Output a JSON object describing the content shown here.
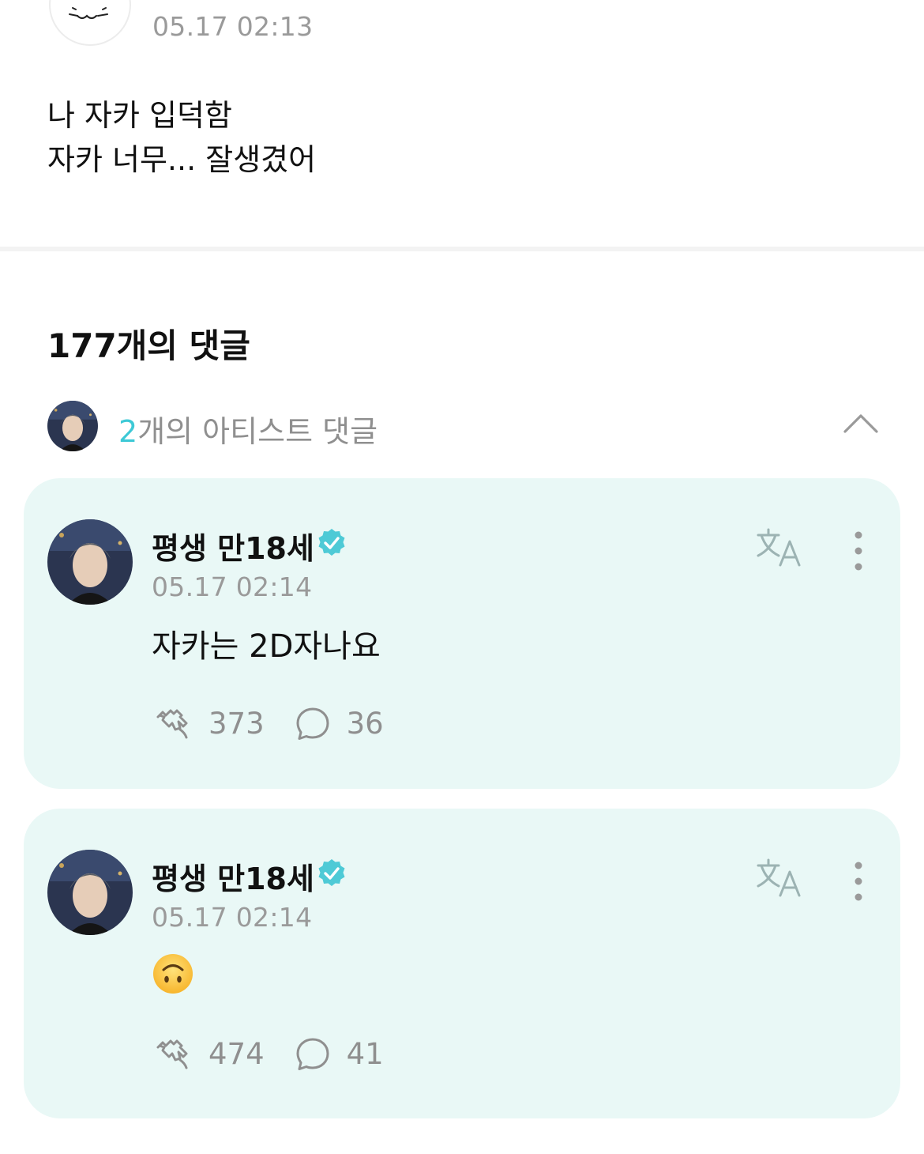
{
  "post": {
    "date": "05.17 02:13",
    "body_lines": [
      "나 자카 입덕함",
      "자카 너무... 잘생겼어"
    ]
  },
  "comments_header": {
    "count_label": "177개의 댓글"
  },
  "artist_comments": {
    "count": "2",
    "label_suffix": "개의 아티스트 댓글",
    "accent_color": "#3ec9d6",
    "card_color": "#e9f8f6"
  },
  "comments": [
    {
      "author": "평생 만18세",
      "verified": true,
      "date": "05.17 02:14",
      "text": "자카는 2D자나요",
      "likes": "373",
      "replies": "36"
    },
    {
      "author": "평생 만18세",
      "verified": true,
      "date": "05.17 02:14",
      "text": "",
      "emoji": "upside-down-face",
      "likes": "474",
      "replies": "41"
    }
  ]
}
